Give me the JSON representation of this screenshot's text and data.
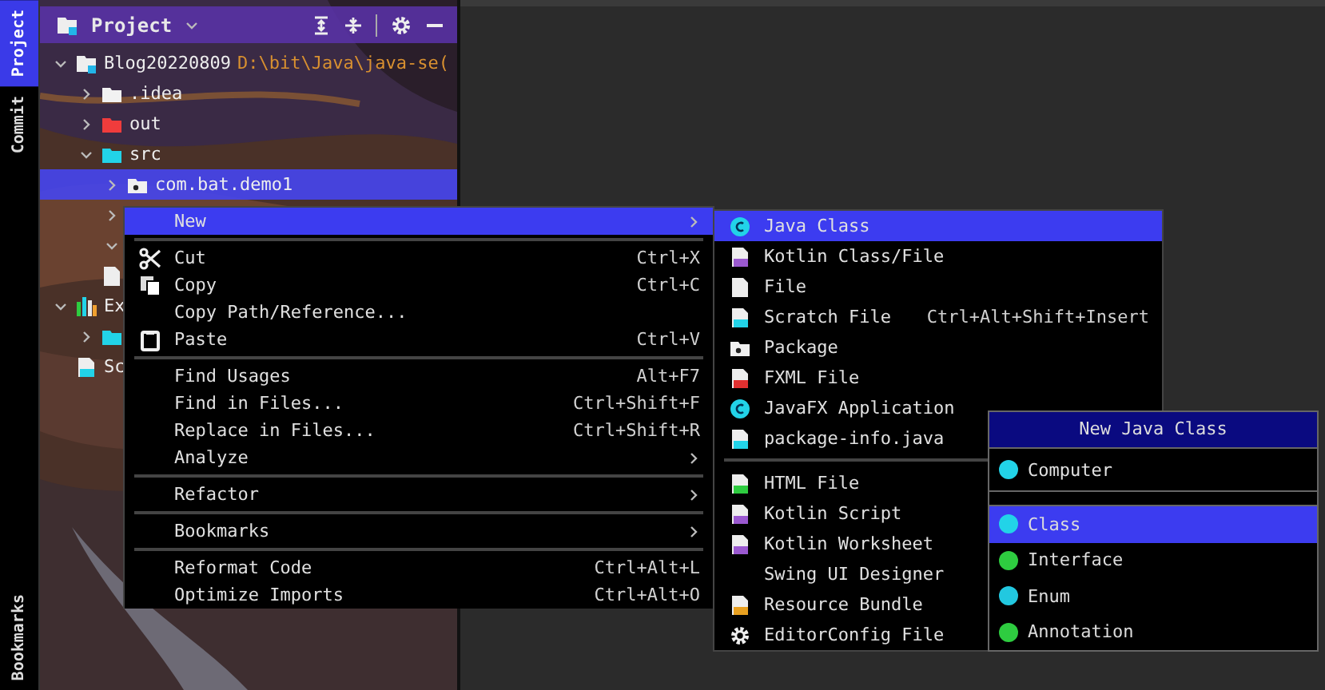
{
  "tool_strip": {
    "top_tabs": [
      {
        "label": "Project",
        "selected": true
      },
      {
        "label": "Commit",
        "selected": false
      }
    ],
    "bottom_tabs": [
      {
        "label": "Bookmarks",
        "selected": false
      }
    ]
  },
  "project_panel": {
    "title": "Project",
    "tree": [
      {
        "label": "Blog20220809",
        "path": "D:\\bit\\Java\\java-se(",
        "kind": "module",
        "expanded": true,
        "selected": false,
        "children": [
          {
            "label": ".idea",
            "kind": "folder",
            "color": "#f2f2f2",
            "expanded": false,
            "selected": false
          },
          {
            "label": "out",
            "kind": "folder",
            "color": "#f03c3c",
            "expanded": false,
            "selected": false
          },
          {
            "label": "src",
            "kind": "folder",
            "color": "#22d3e8",
            "expanded": true,
            "selected": false,
            "children": [
              {
                "label": "com.bat.demo1",
                "kind": "package",
                "expanded": false,
                "selected": true
              },
              {
                "kind": "hidden",
                "expanded": false,
                "selected": false
              },
              {
                "kind": "hidden",
                "expanded": true,
                "selected": false
              }
            ]
          },
          {
            "kind": "file",
            "selected": false
          }
        ]
      },
      {
        "label": "Ex",
        "kind": "library",
        "expanded": true,
        "selected": false,
        "children": [
          {
            "kind": "folder",
            "color": "#22d3e8",
            "expanded": false,
            "selected": false
          }
        ]
      },
      {
        "label": "Sc",
        "kind": "scratch",
        "selected": false
      }
    ]
  },
  "context_menu": {
    "items": [
      {
        "kind": "plain",
        "label": "New",
        "submenu": true,
        "selected": true
      },
      {
        "kind": "separator"
      },
      {
        "kind": "scissors",
        "label": "Cut",
        "shortcut": "Ctrl+X",
        "selected": false
      },
      {
        "kind": "copy",
        "label": "Copy",
        "shortcut": "Ctrl+C",
        "selected": false
      },
      {
        "kind": "plain",
        "label": "Copy Path/Reference...",
        "selected": false
      },
      {
        "kind": "paste",
        "label": "Paste",
        "shortcut": "Ctrl+V",
        "selected": false
      },
      {
        "kind": "separator"
      },
      {
        "kind": "plain",
        "label": "Find Usages",
        "shortcut": "Alt+F7",
        "selected": false
      },
      {
        "kind": "plain",
        "label": "Find in Files...",
        "shortcut": "Ctrl+Shift+F",
        "selected": false
      },
      {
        "kind": "plain",
        "label": "Replace in Files...",
        "shortcut": "Ctrl+Shift+R",
        "selected": false
      },
      {
        "kind": "plain",
        "label": "Analyze",
        "submenu": true,
        "selected": false
      },
      {
        "kind": "separator"
      },
      {
        "kind": "plain",
        "label": "Refactor",
        "submenu": true,
        "selected": false
      },
      {
        "kind": "separator"
      },
      {
        "kind": "plain",
        "label": "Bookmarks",
        "submenu": true,
        "selected": false
      },
      {
        "kind": "separator"
      },
      {
        "kind": "plain",
        "label": "Reformat Code",
        "shortcut": "Ctrl+Alt+L",
        "selected": false
      },
      {
        "kind": "plain",
        "label": "Optimize Imports",
        "shortcut": "Ctrl+Alt+O",
        "selected": false
      }
    ]
  },
  "new_submenu": {
    "items": [
      {
        "kind": "class",
        "label": "Java Class",
        "selected": true
      },
      {
        "kind": "kotlin",
        "label": "Kotlin Class/File",
        "selected": false
      },
      {
        "kind": "file",
        "label": "File",
        "selected": false
      },
      {
        "kind": "scratch",
        "label": "Scratch File",
        "shortcut": "Ctrl+Alt+Shift+Insert",
        "selected": false
      },
      {
        "kind": "package",
        "label": "Package",
        "selected": false
      },
      {
        "kind": "fxml",
        "label": "FXML File",
        "selected": false
      },
      {
        "kind": "class",
        "label": "JavaFX Application",
        "selected": false
      },
      {
        "kind": "javafile",
        "label": "package-info.java",
        "selected": false
      },
      {
        "kind": "separator"
      },
      {
        "kind": "html",
        "label": "HTML File",
        "selected": false
      },
      {
        "kind": "kotlin",
        "label": "Kotlin Script",
        "selected": false
      },
      {
        "kind": "kotlin",
        "label": "Kotlin Worksheet",
        "selected": false
      },
      {
        "kind": "plain",
        "label": "Swing UI Designer",
        "selected": false
      },
      {
        "kind": "resource",
        "label": "Resource Bundle",
        "selected": false
      },
      {
        "kind": "gear",
        "label": "EditorConfig File",
        "selected": false
      }
    ]
  },
  "new_class_dialog": {
    "title": "New Java Class",
    "name_field": {
      "value": "Computer",
      "color": "#22d3e8"
    },
    "kinds": [
      {
        "label": "Class",
        "color": "#22d3e8",
        "selected": true
      },
      {
        "label": "Interface",
        "color": "#2ecc40",
        "selected": false
      },
      {
        "label": "Enum",
        "color": "#22c8e0",
        "selected": false
      },
      {
        "label": "Annotation",
        "color": "#2ecc40",
        "selected": false
      }
    ]
  }
}
